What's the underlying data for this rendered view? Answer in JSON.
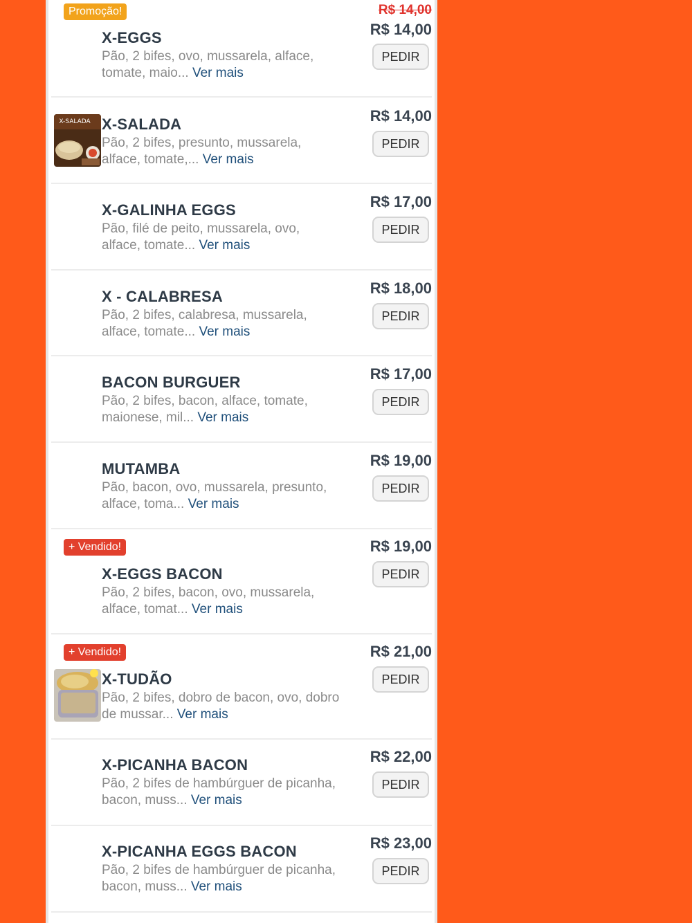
{
  "colors": {
    "background": "#ff5a1a",
    "promo_badge": "#f2a31b",
    "sold_badge": "#e2402d",
    "link": "#1f4f7a"
  },
  "items": [
    {
      "badge": "Promoção!",
      "name": "X-EGGS",
      "desc": "Pão, 2 bifes, ovo, mussarela, alface, tomate, maio...",
      "more": "Ver mais",
      "old_price": "R$ 14,00",
      "price": "R$ 14,00",
      "button": "PEDIR"
    },
    {
      "name": "X-SALADA",
      "desc": "Pão, 2 bifes, presunto, mussarela, alface, tomate,...",
      "more": "Ver mais",
      "price": "R$ 14,00",
      "button": "PEDIR",
      "thumb_text": "X-SALADA"
    },
    {
      "name": "X-GALINHA EGGS",
      "desc": "Pão, filé de peito, mussarela, ovo, alface, tomate...",
      "more": "Ver mais",
      "price": "R$ 17,00",
      "button": "PEDIR"
    },
    {
      "name": "X - CALABRESA",
      "desc": "Pão, 2 bifes, calabresa, mussarela, alface, tomate...",
      "more": "Ver mais",
      "price": "R$ 18,00",
      "button": "PEDIR"
    },
    {
      "name": "BACON BURGUER",
      "desc": "Pão, 2 bifes, bacon, alface, tomate, maionese, mil...",
      "more": "Ver mais",
      "price": "R$ 17,00",
      "button": "PEDIR"
    },
    {
      "name": "MUTAMBA",
      "desc": "Pão, bacon, ovo, mussarela, presunto, alface, toma...",
      "more": "Ver mais",
      "price": "R$ 19,00",
      "button": "PEDIR"
    },
    {
      "badge": "+ Vendido!",
      "name": "X-EGGS BACON",
      "desc": "Pão, 2 bifes, bacon, ovo, mussarela, alface, tomat...",
      "more": "Ver mais",
      "price": "R$ 19,00",
      "button": "PEDIR"
    },
    {
      "badge": "+ Vendido!",
      "name": "X-TUDÃO",
      "desc": "Pão, 2 bifes, dobro de bacon, ovo, dobro de mussar...",
      "more": "Ver mais",
      "price": "R$ 21,00",
      "button": "PEDIR"
    },
    {
      "name": "X-PICANHA BACON",
      "desc": "Pão, 2 bifes de hambúrguer de picanha, bacon, muss...",
      "more": "Ver mais",
      "price": "R$ 22,00",
      "button": "PEDIR"
    },
    {
      "name": "X-PICANHA EGGS BACON",
      "desc": "Pão, 2 bifes de hambúrguer de picanha, bacon, muss...",
      "more": "Ver mais",
      "price": "R$ 23,00",
      "button": "PEDIR"
    }
  ]
}
